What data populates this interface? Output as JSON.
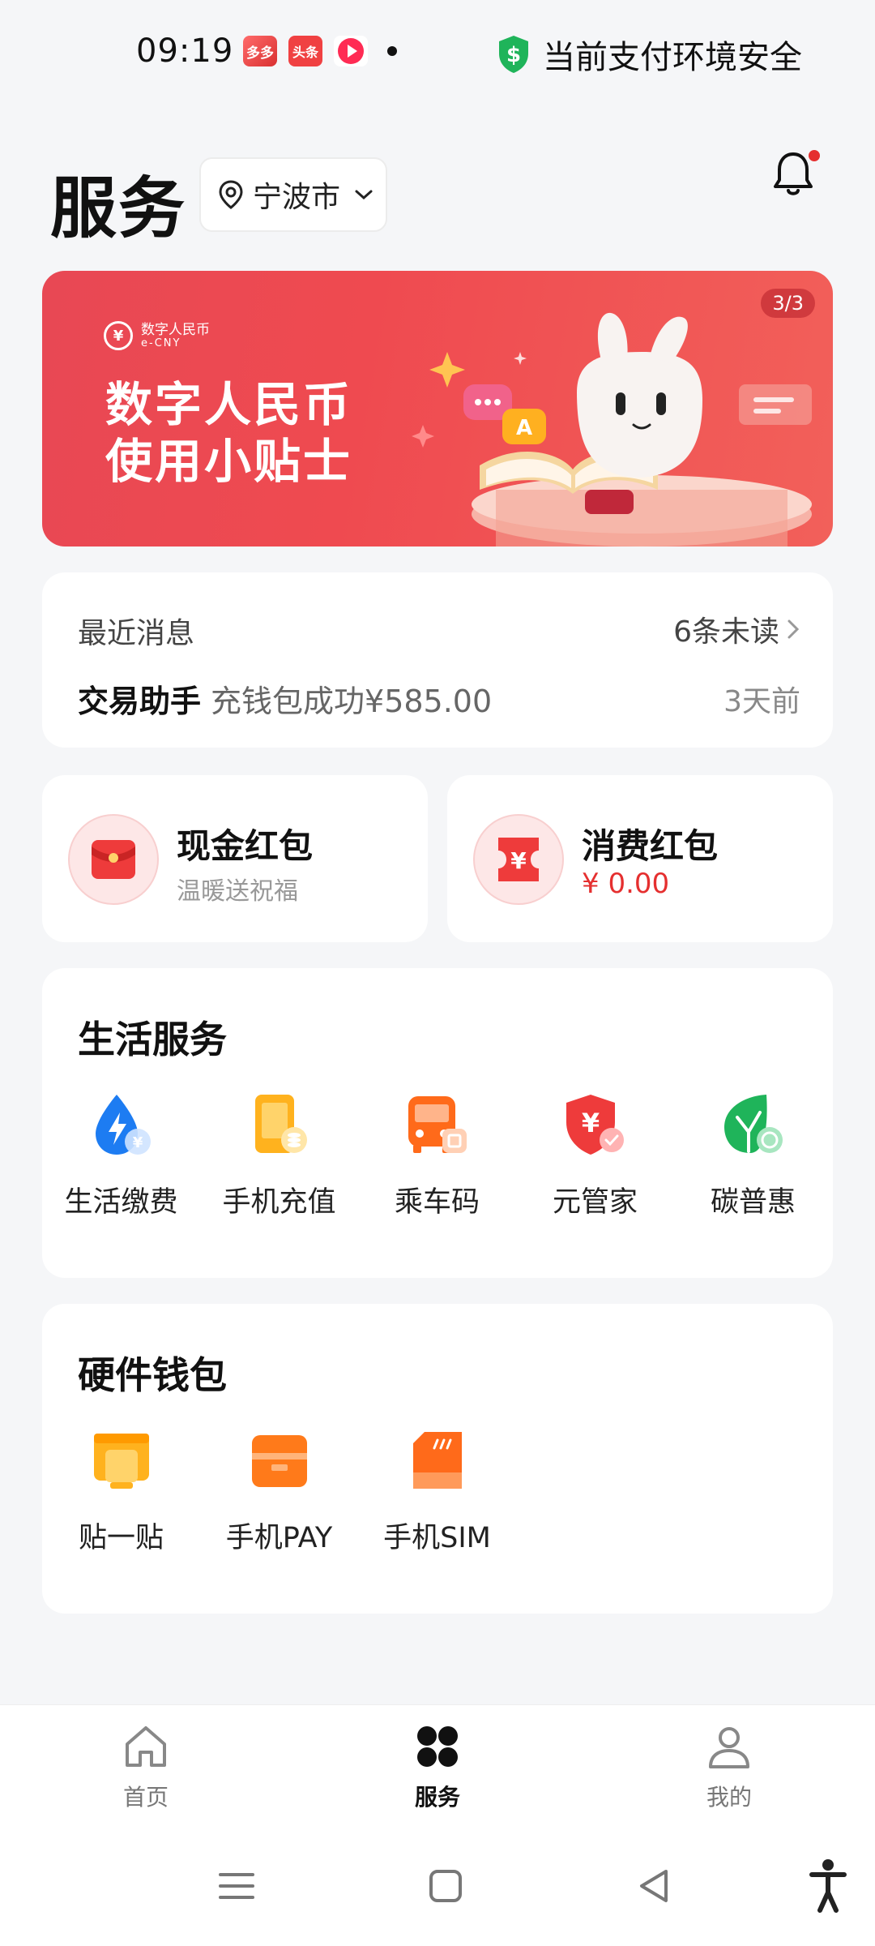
{
  "status_bar": {
    "time": "09:19",
    "apps": [
      {
        "icon": "pinduoduo-app-icon",
        "text": "多多"
      },
      {
        "icon": "toutiao-app-icon",
        "text": "头条"
      },
      {
        "icon": "video-app-icon",
        "text": ""
      }
    ],
    "security_text": "当前支付环境安全"
  },
  "header": {
    "title": "服务",
    "city": "宁波市"
  },
  "banner": {
    "brand_name": "数字人民币",
    "brand_sub": "e-CNY",
    "title_line1": "数字人民币",
    "title_line2": "使用小贴士",
    "page_indicator": "3/3"
  },
  "messages": {
    "header": "最近消息",
    "unread": "6条未读",
    "sender": "交易助手",
    "content": "充钱包成功¥585.00",
    "time": "3天前"
  },
  "red_packets": [
    {
      "title": "现金红包",
      "subtitle": "温暖送祝福"
    },
    {
      "title": "消费红包",
      "amount": "¥ 0.00"
    }
  ],
  "life_services": {
    "title": "生活服务",
    "items": [
      {
        "label": "生活缴费",
        "icon": "utility-bill-icon"
      },
      {
        "label": "手机充值",
        "icon": "phone-recharge-icon"
      },
      {
        "label": "乘车码",
        "icon": "bus-code-icon"
      },
      {
        "label": "元管家",
        "icon": "yuan-steward-icon"
      },
      {
        "label": "碳普惠",
        "icon": "carbon-inclusive-icon"
      }
    ]
  },
  "hardware_wallet": {
    "title": "硬件钱包",
    "items": [
      {
        "label": "贴一贴",
        "icon": "tap-card-icon"
      },
      {
        "label": "手机PAY",
        "icon": "phone-pay-icon"
      },
      {
        "label": "手机SIM",
        "icon": "sim-card-icon"
      }
    ]
  },
  "bottom_nav": [
    {
      "label": "首页",
      "icon": "home-icon"
    },
    {
      "label": "服务",
      "icon": "services-icon",
      "active": true
    },
    {
      "label": "我的",
      "icon": "profile-icon"
    }
  ],
  "colors": {
    "accent_red": "#e52f2f",
    "banner_red": "#ef4a50",
    "secure_green": "#1fb45a"
  }
}
